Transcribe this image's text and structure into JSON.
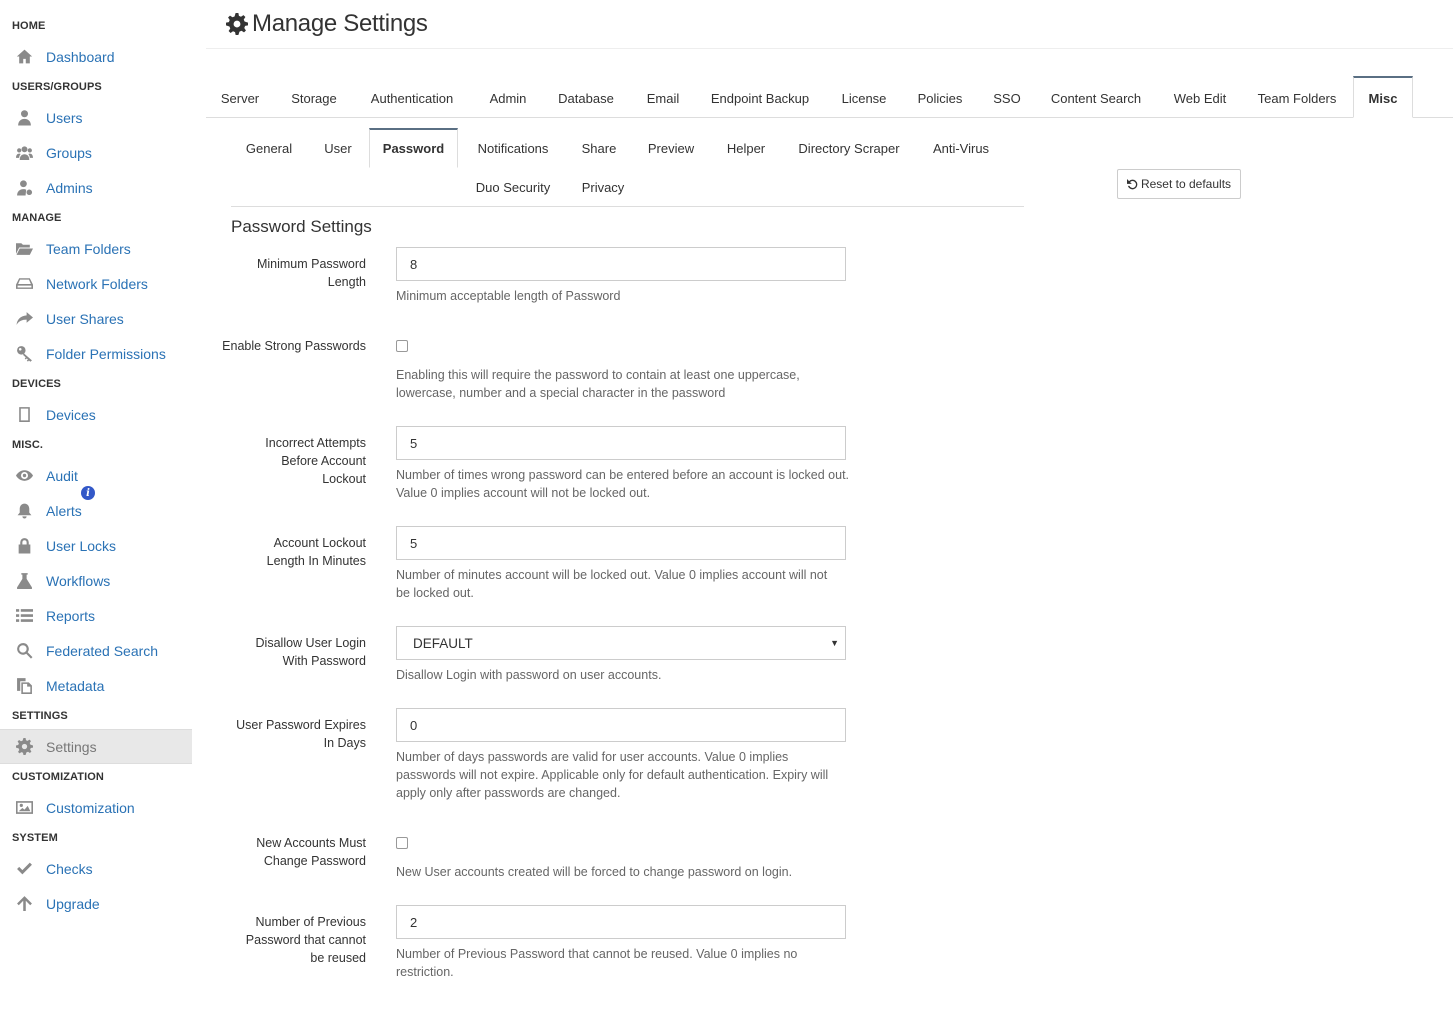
{
  "sidebar": {
    "sections": {
      "home": "HOME",
      "users_groups": "USERS/GROUPS",
      "manage": "MANAGE",
      "devices": "DEVICES",
      "misc": "MISC.",
      "settings": "SETTINGS",
      "customization": "CUSTOMIZATION",
      "system": "SYSTEM"
    },
    "items": {
      "dashboard": "Dashboard",
      "users": "Users",
      "groups": "Groups",
      "admins": "Admins",
      "team_folders": "Team Folders",
      "network_folders": "Network Folders",
      "user_shares": "User Shares",
      "folder_permissions": "Folder Permissions",
      "devices": "Devices",
      "audit": "Audit",
      "alerts": "Alerts",
      "user_locks": "User Locks",
      "workflows": "Workflows",
      "reports": "Reports",
      "federated_search": "Federated Search",
      "metadata": "Metadata",
      "settings": "Settings",
      "customization": "Customization",
      "checks": "Checks",
      "upgrade": "Upgrade"
    },
    "alerts_badge": "i",
    "active_item": "Settings"
  },
  "header": {
    "title": "Manage Settings"
  },
  "main_tabs": [
    "Server",
    "Storage",
    "Authentication",
    "Admin",
    "Database",
    "Email",
    "Endpoint Backup",
    "License",
    "Policies",
    "SSO",
    "Content Search",
    "Web Edit",
    "Team Folders",
    "Misc"
  ],
  "active_main_tab": "Misc",
  "sub_tabs": [
    "General",
    "User",
    "Password",
    "Notifications",
    "Share",
    "Preview",
    "Helper",
    "Directory Scraper",
    "Anti-Virus",
    "Duo Security",
    "Privacy"
  ],
  "active_sub_tab": "Password",
  "reset_button": "Reset to defaults",
  "form": {
    "section_title": "Password Settings",
    "fields": {
      "min_length": {
        "label": "Minimum Password Length",
        "value": "8",
        "help": "Minimum acceptable length of Password"
      },
      "strong_passwords": {
        "label": "Enable Strong Passwords",
        "checked": false,
        "help": "Enabling this will require the password to contain at least one uppercase, lowercase, number and a special character in the password"
      },
      "incorrect_attempts": {
        "label": "Incorrect Attempts Before Account Lockout",
        "value": "5",
        "help": "Number of times wrong password can be entered before an account is locked out. Value 0 implies account will not be locked out."
      },
      "lockout_length": {
        "label": "Account Lockout Length In Minutes",
        "value": "5",
        "help": "Number of minutes account will be locked out. Value 0 implies account will not be locked out."
      },
      "disallow_login": {
        "label": "Disallow User Login With Password",
        "value": "DEFAULT",
        "help": "Disallow Login with password on user accounts."
      },
      "password_expires": {
        "label": "User Password Expires In Days",
        "value": "0",
        "help": "Number of days passwords are valid for user accounts. Value 0 implies passwords will not expire. Applicable only for default authentication. Expiry will apply only after passwords are changed."
      },
      "must_change": {
        "label": "New Accounts Must Change Password",
        "checked": false,
        "help": "New User accounts created will be forced to change password on login."
      },
      "previous_passwords": {
        "label": "Number of Previous Password that cannot be reused",
        "value": "2",
        "help": "Number of Previous Password that cannot be reused. Value 0 implies no restriction."
      }
    }
  },
  "colors": {
    "link": "#2a72b5",
    "icon": "#8a8a8a",
    "active_tab_border": "#5a6f83"
  }
}
